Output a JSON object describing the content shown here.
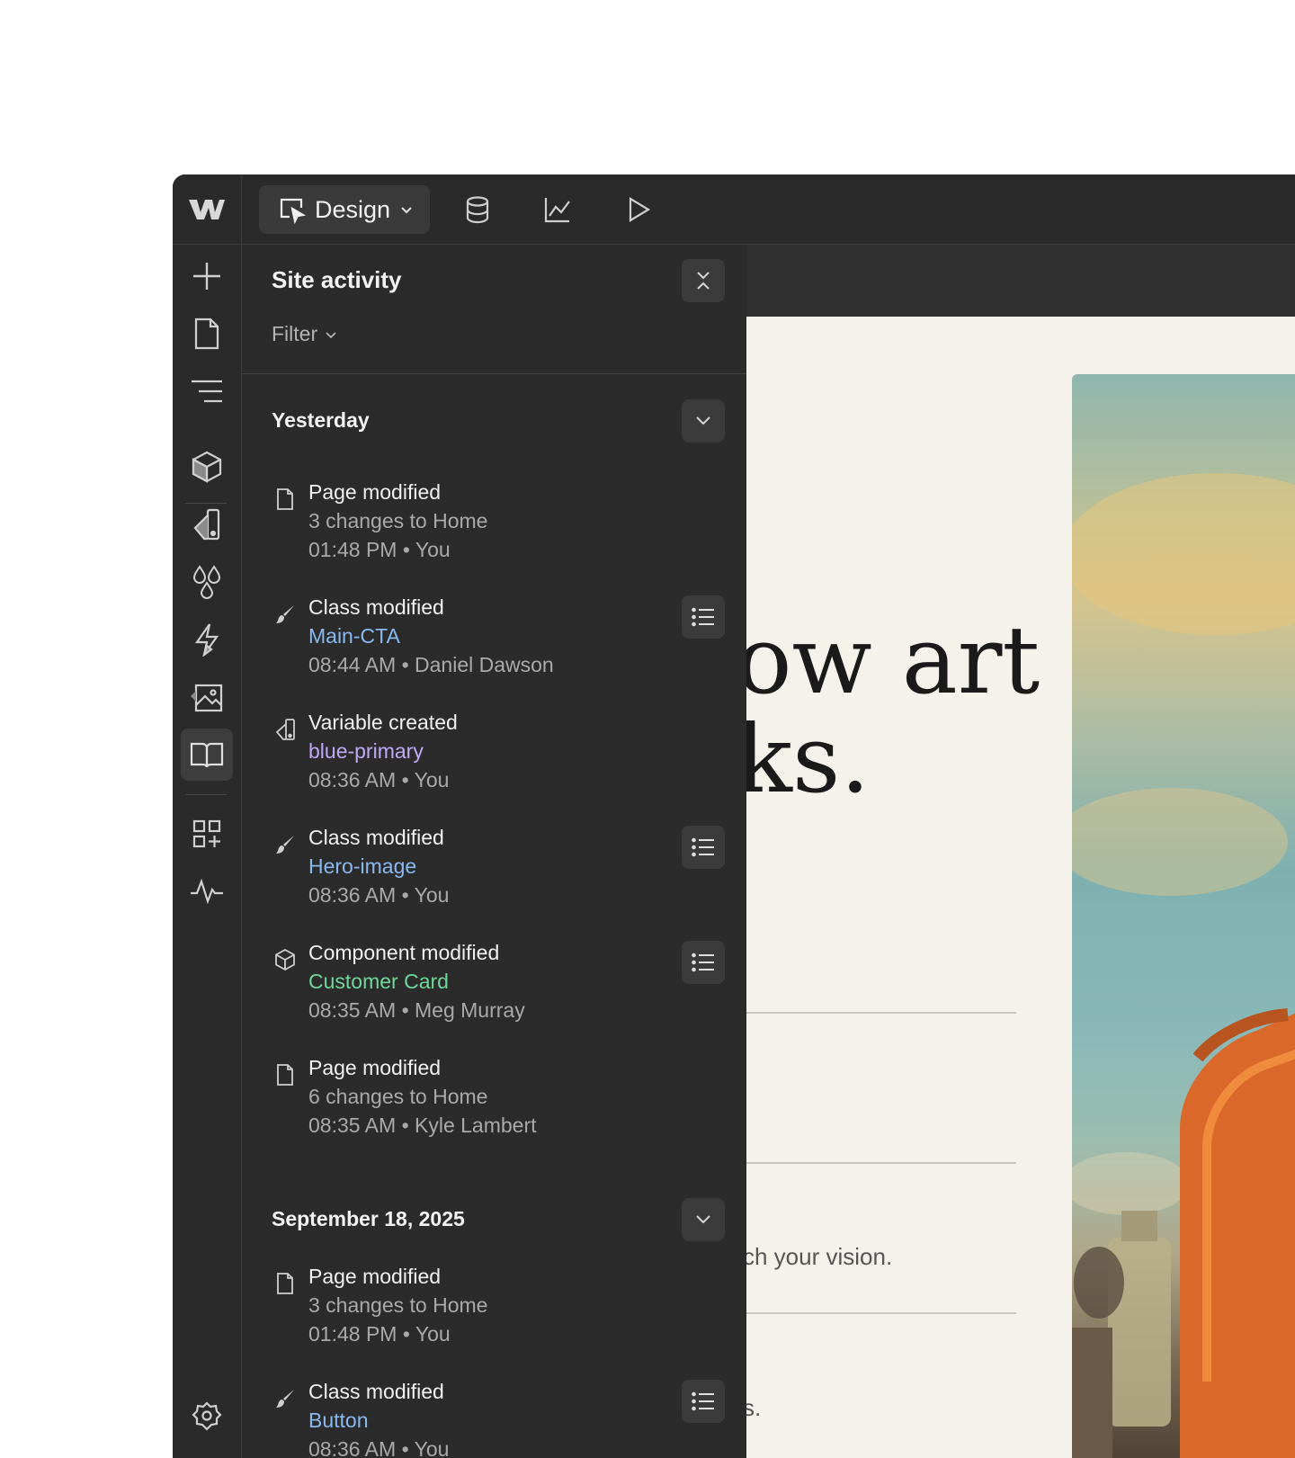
{
  "topbar": {
    "mode_label": "Design"
  },
  "panel": {
    "title": "Site activity",
    "filter_label": "Filter",
    "groups": [
      {
        "heading": "Yesterday",
        "entries": [
          {
            "icon": "page-icon",
            "title": "Page modified",
            "subtitle": "3 changes to Home",
            "meta": "01:48 PM • You"
          },
          {
            "icon": "brush-icon",
            "title": "Class modified",
            "subtitle": "Main-CTA",
            "meta": "08:44 AM • Daniel Dawson"
          },
          {
            "icon": "variable-icon",
            "title": "Variable created",
            "subtitle": "blue-primary",
            "meta": "08:36 AM • You"
          },
          {
            "icon": "brush-icon",
            "title": "Class modified",
            "subtitle": "Hero-image",
            "meta": "08:36 AM • You"
          },
          {
            "icon": "component-icon",
            "title": "Component modified",
            "subtitle": "Customer Card",
            "meta": "08:35 AM • Meg Murray"
          },
          {
            "icon": "page-icon",
            "title": "Page modified",
            "subtitle": "6 changes to Home",
            "meta": "08:35 AM • Kyle Lambert"
          }
        ]
      },
      {
        "heading": "September 18, 2025",
        "entries": [
          {
            "icon": "page-icon",
            "title": "Page modified",
            "subtitle": "3 changes to Home",
            "meta": "01:48 PM • You"
          },
          {
            "icon": "brush-icon",
            "title": "Class modified",
            "subtitle": "Button",
            "meta": "08:36 AM • You"
          }
        ]
      }
    ]
  },
  "canvas": {
    "hero_line1": "ow art",
    "hero_line2": "ks.",
    "body_line1": "ch your vision.",
    "body_line2": "s."
  }
}
